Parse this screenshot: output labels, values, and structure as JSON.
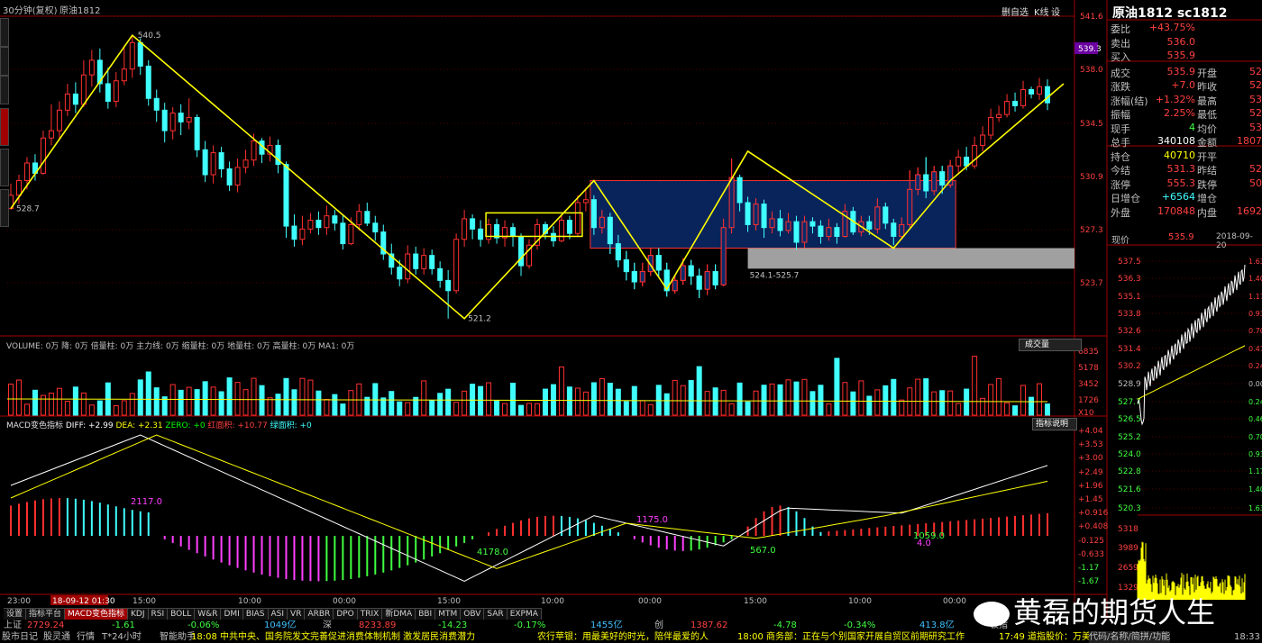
{
  "header": {
    "period": "30分钟(复权)",
    "symbol": "原油1812",
    "btn_zoom": "删自选",
    "btn_k": "K线",
    "btn_setting": "设"
  },
  "price_axis": [
    "541.6",
    "538.0",
    "534.5",
    "530.9",
    "527.3",
    "523.7"
  ],
  "price_tag": "539.3",
  "annotations": {
    "high": "540.5",
    "low": "521.2",
    "start": "528.7",
    "zone": "524.1-525.7"
  },
  "volume_panel": {
    "title": "VOLUME: 0万  降: 0万  倍量柱: 0万  主力线: 0万  缩量柱: 0万  地量柱: 0万  高量柱: 0万  MA1: 0万",
    "btn": "成交量",
    "axis": [
      "6835",
      "5178",
      "3452",
      "1726",
      "X10"
    ]
  },
  "macd_panel": {
    "title_name": "MACD变色指标",
    "diff": "DIFF: +2.99",
    "dea": "DEA: +2.31",
    "zero": "ZERO: +0",
    "red_area": "红面积: +10.77",
    "green_area": "绿面积: +0",
    "btn": "指标说明",
    "axis": [
      "+4.04",
      "+3.53",
      "+3.00",
      "+2.49",
      "+1.96",
      "+1.45",
      "+0.916",
      "+0.408",
      "-0.125",
      "-0.633",
      "-1.17",
      "-1.67"
    ],
    "labels": [
      "2117.0",
      "4178.0",
      "1175.0",
      "567.0",
      "1059.0",
      "4.0"
    ]
  },
  "time_axis": [
    "23:00",
    "18-09-12 01:30",
    "15:00",
    "10:00",
    "00:00",
    "15:00",
    "10:00",
    "00:00",
    "15:00",
    "10:00",
    "00:00"
  ],
  "tabs": [
    "设置",
    "指标平台",
    "MACD变色指标",
    "KDJ",
    "RSI",
    "BOLL",
    "W&R",
    "DMI",
    "BIAS",
    "ASI",
    "VR",
    "ARBR",
    "DPO",
    "TRIX",
    "新DMA",
    "BBI",
    "MTM",
    "OBV",
    "SAR",
    "EXPMA"
  ],
  "quote": {
    "title": "原油1812 sc1812",
    "rows": [
      {
        "l1": "委比",
        "v1": "+43.75%",
        "l2": "",
        "v2": ""
      },
      {
        "l1": "卖出",
        "v1": "536.0",
        "l2": "",
        "v2": ""
      },
      {
        "l1": "买入",
        "v1": "535.9",
        "l2": "",
        "v2": ""
      },
      {
        "l1": "成交",
        "v1": "535.9",
        "l2": "开盘",
        "v2": "52"
      },
      {
        "l1": "涨跌",
        "v1": "+7.0",
        "l2": "昨收",
        "v2": "52"
      },
      {
        "l1": "涨幅(结)",
        "v1": "+1.32%",
        "l2": "最高",
        "v2": "53"
      },
      {
        "l1": "振幅",
        "v1": "2.25%",
        "l2": "最低",
        "v2": "52"
      },
      {
        "l1": "现手",
        "v1": "4",
        "l2": "均价",
        "v2": "53"
      },
      {
        "l1": "总手",
        "v1": "340108",
        "l2": "金额",
        "v2": "1807"
      },
      {
        "l1": "持仓",
        "v1": "40710",
        "l2": "开平",
        "v2": ""
      },
      {
        "l1": "今结",
        "v1": "531.3",
        "l2": "昨结",
        "v2": "52"
      },
      {
        "l1": "涨停",
        "v1": "555.3",
        "l2": "跌停",
        "v2": "50"
      },
      {
        "l1": "日增仓",
        "v1": "+6564",
        "l2": "增仓",
        "v2": ""
      },
      {
        "l1": "外盘",
        "v1": "170848",
        "l2": "内盘",
        "v2": "1692"
      }
    ],
    "intraday_label": "现价",
    "intraday_price": "535.9",
    "intraday_date": "2018-09-20",
    "intraday_left_axis": [
      "537.5",
      "536.3",
      "535.1",
      "533.8",
      "532.6",
      "531.4",
      "530.2",
      "528.9",
      "527.7",
      "526.5",
      "525.2",
      "524.0",
      "522.8",
      "521.6",
      "520.3",
      "5318",
      "3989",
      "2659",
      "1329"
    ],
    "intraday_right_axis": [
      "1.63",
      "1.40",
      "1.17",
      "0.93",
      "0.70",
      "0.47",
      "0.24",
      "0.00",
      "0.24",
      "0.46",
      "0.70",
      "0.93",
      "1.17",
      "1.40",
      "1.63"
    ]
  },
  "status": {
    "line1": [
      {
        "t": "上证",
        "c": "#c0c0c0"
      },
      {
        "t": "2729.24",
        "c": "#ff4040"
      },
      {
        "t": "-1.61",
        "c": "#40ff40"
      },
      {
        "t": "-0.06%",
        "c": "#40ff40"
      },
      {
        "t": "1049亿",
        "c": "#40c0ff"
      },
      {
        "t": "深",
        "c": "#c0c0c0"
      },
      {
        "t": "8233.89",
        "c": "#ff4040"
      },
      {
        "t": "-14.23",
        "c": "#40ff40"
      },
      {
        "t": "-0.17%",
        "c": "#40ff40"
      },
      {
        "t": "1455亿",
        "c": "#40c0ff"
      },
      {
        "t": "创",
        "c": "#c0c0c0"
      },
      {
        "t": "1387.62",
        "c": "#ff4040"
      },
      {
        "t": "-4.78",
        "c": "#40ff40"
      },
      {
        "t": "-0.34%",
        "c": "#40ff40"
      },
      {
        "t": "413.8亿",
        "c": "#40c0ff"
      },
      {
        "t": "板指",
        "c": "#c0c0c0"
      }
    ],
    "line2_left": [
      "股市日记",
      "股灵通",
      "行情",
      "T*24小时",
      "智能助手"
    ],
    "news1": "18:08 中共中央、国务院发文完善促进消费体制机制 激发居民消费潜力",
    "news2": "农行苹银：用最美好的时光，陪伴最爱的人",
    "news3": "18:00 商务部：正在与个别国家开展自贸区前期研究工作",
    "news4": "17:49 道指股价：万美",
    "right_icons": "代码/名称/简拼/功能",
    "clock": "18:33"
  },
  "watermark": "黄磊的期货人生"
}
